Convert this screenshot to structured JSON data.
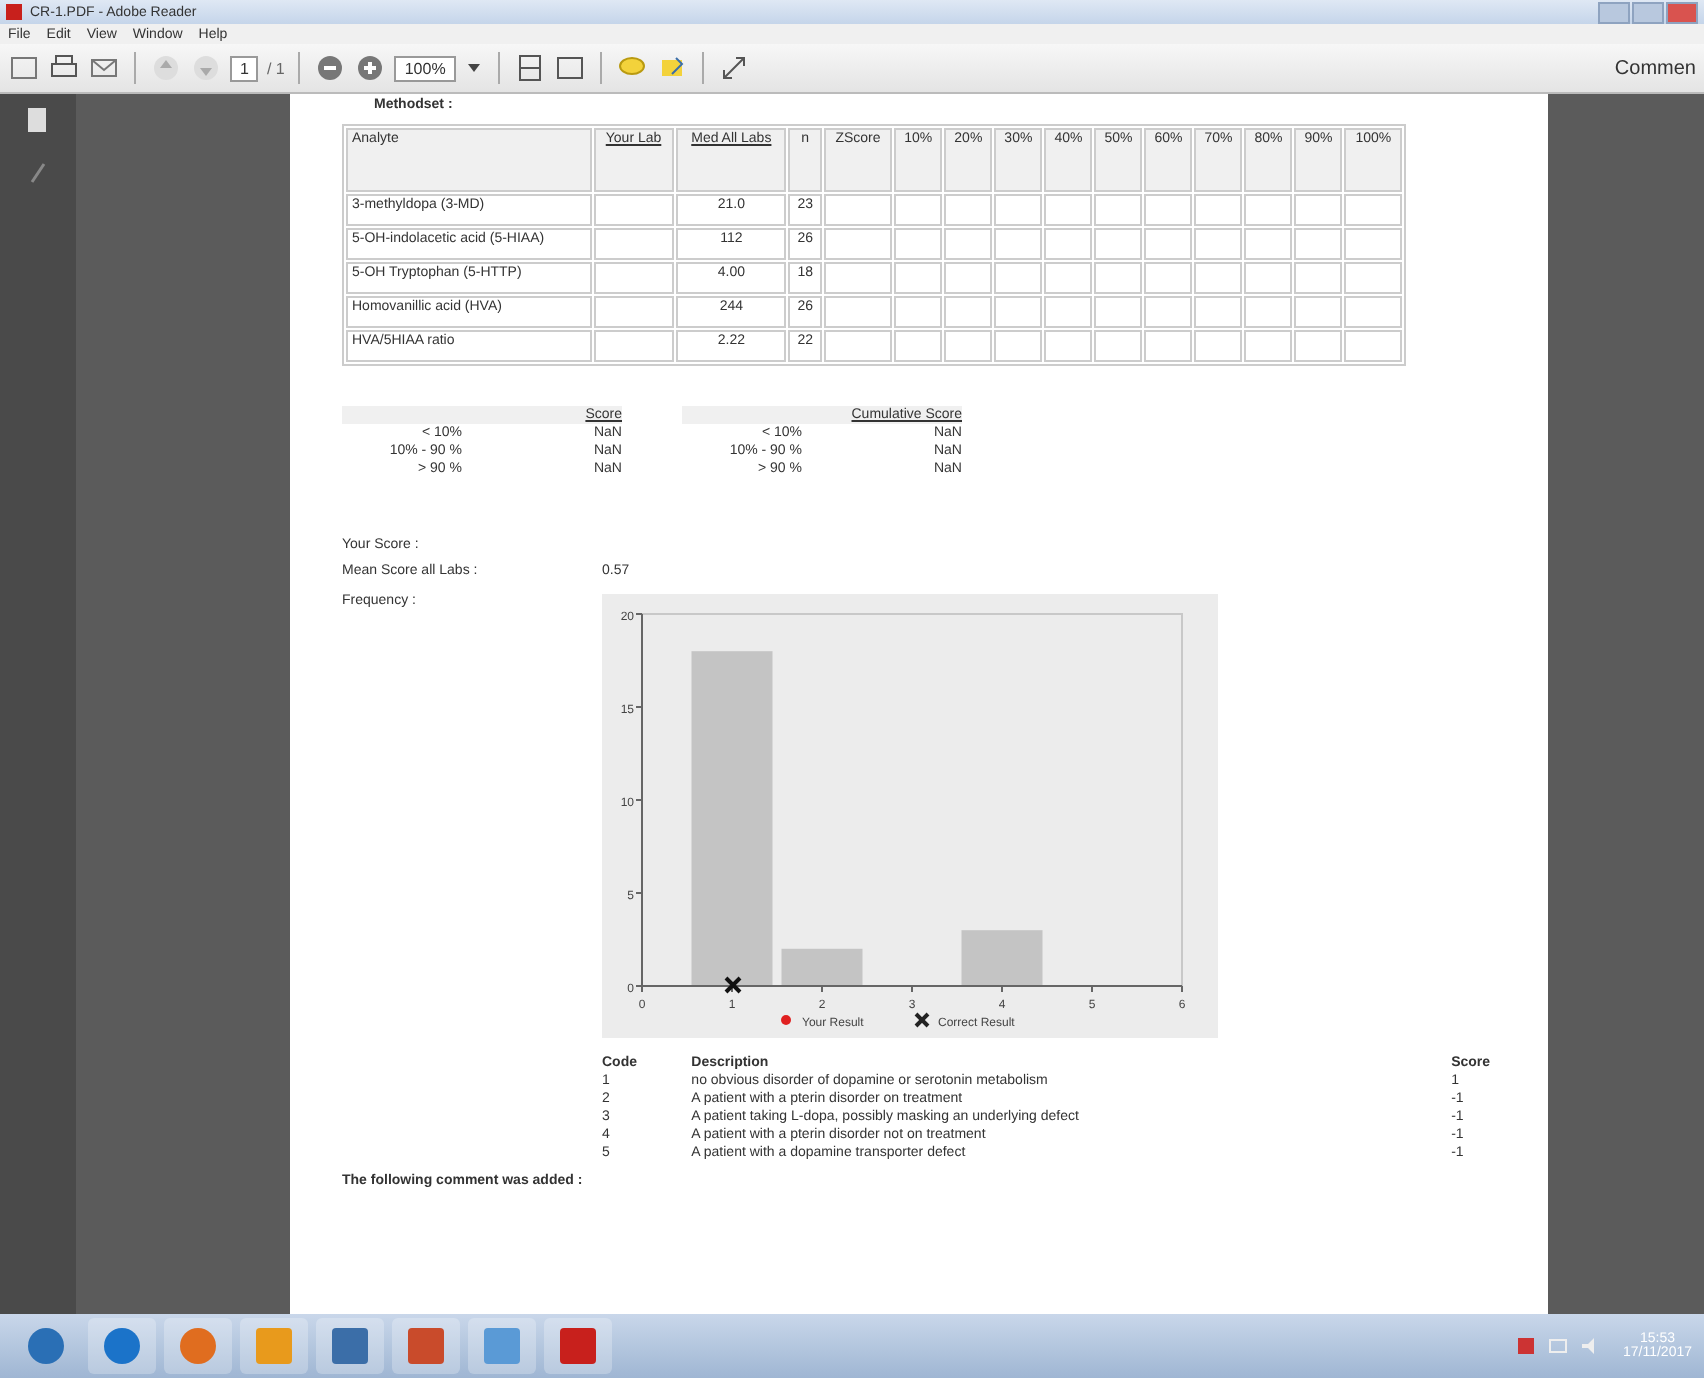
{
  "window": {
    "title": "CR-1.PDF - Adobe Reader"
  },
  "menu": [
    "File",
    "Edit",
    "View",
    "Window",
    "Help"
  ],
  "toolbar": {
    "page": "1",
    "page_total": "/ 1",
    "zoom": "100%",
    "comment": "Commen"
  },
  "document": {
    "section_title": "Methodset :",
    "analytes": {
      "columns": [
        "Analyte",
        "Your Lab",
        "Med All Labs",
        "n",
        "ZScore",
        "10%",
        "20%",
        "30%",
        "40%",
        "50%",
        "60%",
        "70%",
        "80%",
        "90%",
        "100%"
      ],
      "rows": [
        [
          "3-methyldopa (3-MD)",
          "",
          "21.0",
          "23"
        ],
        [
          "5-OH-indolacetic acid (5-HIAA)",
          "",
          "112",
          "26"
        ],
        [
          "5-OH Tryptophan (5-HTTP)",
          "",
          "4.00",
          "18"
        ],
        [
          "Homovanillic acid (HVA)",
          "",
          "244",
          "26"
        ],
        [
          "HVA/5HIAA ratio",
          "",
          "2.22",
          "22"
        ]
      ]
    },
    "scores": [
      {
        "heading": "Score",
        "rows": [
          [
            "< 10%",
            "NaN"
          ],
          [
            "10% - 90 %",
            "NaN"
          ],
          [
            "> 90 %",
            "NaN"
          ]
        ]
      },
      {
        "heading": "Cumulative Score",
        "rows": [
          [
            "< 10%",
            "NaN"
          ],
          [
            "10% - 90 %",
            "NaN"
          ],
          [
            "> 90 %",
            "NaN"
          ]
        ]
      }
    ],
    "your_score_label": "Your Score :",
    "mean_score_label": "Mean Score all Labs :",
    "mean_score": "0.57",
    "frequency_label": "Frequency :",
    "chart_data": {
      "type": "bar",
      "categories": [
        "0",
        "1",
        "2",
        "3",
        "4",
        "5",
        "6"
      ],
      "values": [
        0,
        18,
        2,
        0,
        3,
        0,
        0
      ],
      "ylim": [
        0,
        20
      ],
      "yticks": [
        0,
        5,
        10,
        15,
        20
      ],
      "annotations": [
        {
          "x": "1"
        }
      ]
    },
    "legend": [
      {
        "label": "Your Result",
        "kind": "dot",
        "color": "#e02020"
      },
      {
        "label": "Correct Result",
        "kind": "cross",
        "color": "#222222"
      }
    ],
    "codes": {
      "columns": [
        "Code",
        "Description",
        "Score"
      ],
      "rows": [
        [
          "1",
          "no obvious disorder of dopamine or serotonin metabolism",
          "1"
        ],
        [
          "2",
          "A patient with a pterin disorder on treatment",
          "-1"
        ],
        [
          "3",
          "A patient taking L-dopa, possibly masking an underlying defect",
          "-1"
        ],
        [
          "4",
          "A patient with a pterin disorder not on treatment",
          "-1"
        ],
        [
          "5",
          "A patient with a dopamine transporter defect",
          "-1"
        ]
      ]
    },
    "comment_heading": "The following comment was added :"
  },
  "taskbar": {
    "time": "15:53",
    "date": "17/11/2017"
  }
}
